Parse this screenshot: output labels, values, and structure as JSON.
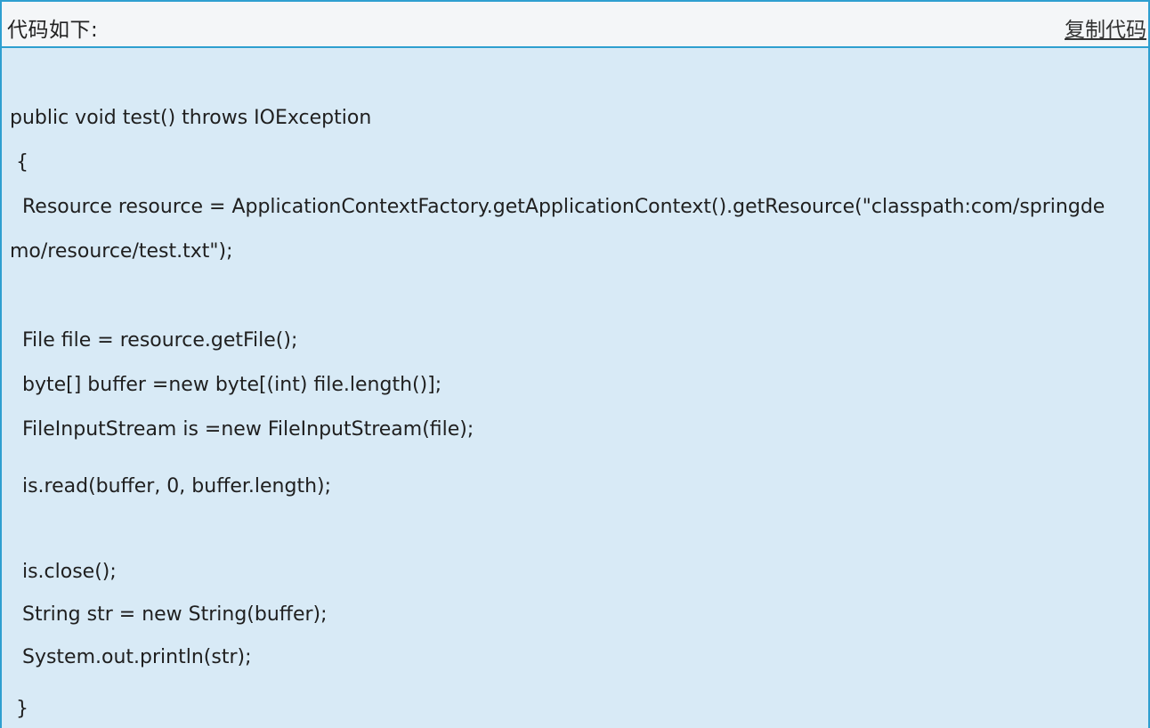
{
  "header": {
    "title": "代码如下:",
    "copy_label": "复制代码"
  },
  "code": {
    "lines": [
      "public void test() throws IOException",
      " {",
      "  Resource resource = ApplicationContextFactory.getApplicationContext().getResource(\"classpath:com/springde",
      "mo/resource/test.txt\");",
      "",
      "  File file = resource.getFile();",
      "  byte[] buffer =new byte[(int) file.length()];",
      "  FileInputStream is =new FileInputStream(file);",
      "  is.read(buffer, 0, buffer.length);",
      "",
      "  is.close();",
      "  String str = new String(buffer);",
      "  System.out.println(str);",
      " }"
    ]
  },
  "colors": {
    "border": "#2e9fd0",
    "code_background": "#d8eaf6",
    "header_background": "#f4f6f8"
  }
}
